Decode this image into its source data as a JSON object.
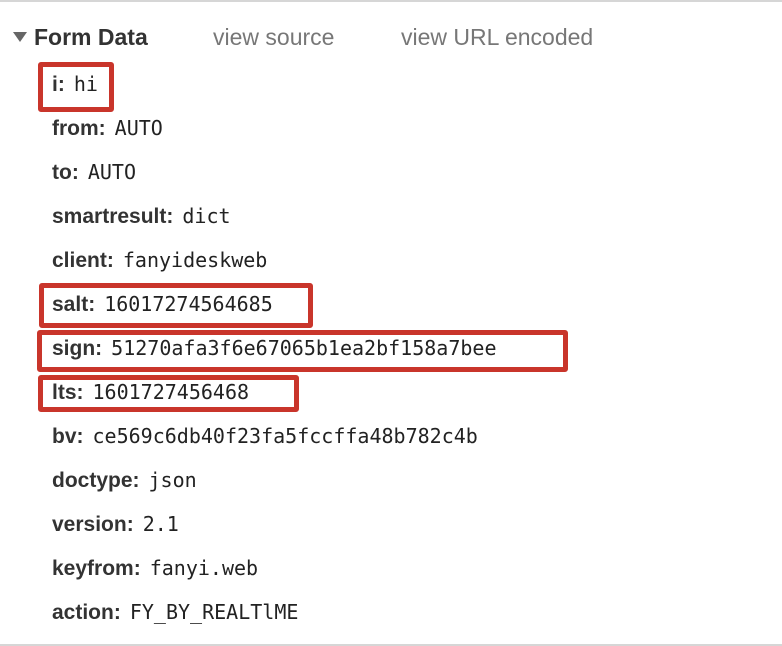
{
  "header": {
    "title": "Form Data",
    "view_source": "view source",
    "view_url_encoded": "view URL encoded"
  },
  "rows": [
    {
      "key": "i",
      "value": "hi"
    },
    {
      "key": "from",
      "value": "AUTO"
    },
    {
      "key": "to",
      "value": "AUTO"
    },
    {
      "key": "smartresult",
      "value": "dict"
    },
    {
      "key": "client",
      "value": "fanyideskweb"
    },
    {
      "key": "salt",
      "value": "16017274564685"
    },
    {
      "key": "sign",
      "value": "51270afa3f6e67065b1ea2bf158a7bee"
    },
    {
      "key": "lts",
      "value": "1601727456468"
    },
    {
      "key": "bv",
      "value": "ce569c6db40f23fa5fccffa48b782c4b"
    },
    {
      "key": "doctype",
      "value": "json"
    },
    {
      "key": "version",
      "value": "2.1"
    },
    {
      "key": "keyfrom",
      "value": "fanyi.web"
    },
    {
      "key": "action",
      "value": "FY_BY_REALTlME"
    }
  ],
  "colors": {
    "highlight": "#c9352b",
    "key_text": "#333333",
    "link_text": "#777777"
  }
}
